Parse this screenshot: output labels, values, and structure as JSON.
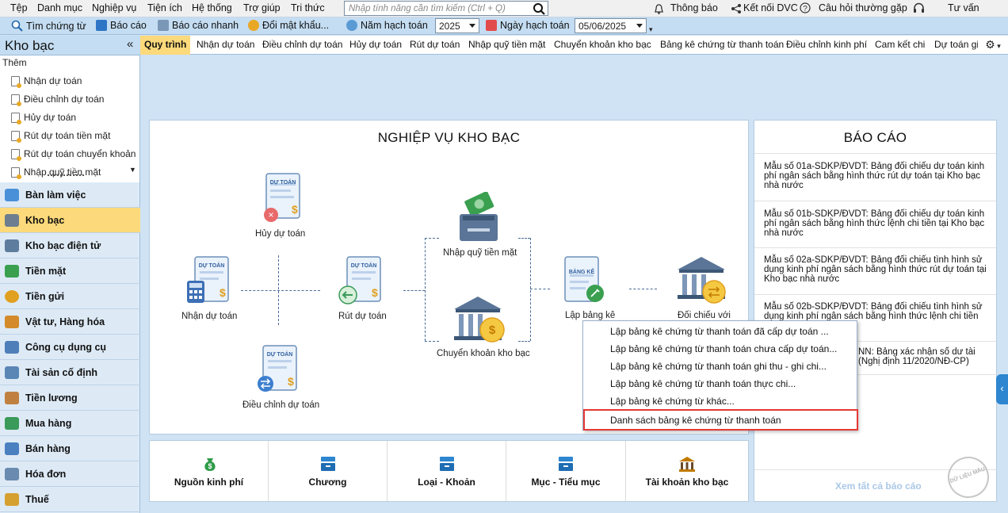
{
  "menubar": {
    "items": [
      "Tệp",
      "Danh mục",
      "Nghiệp vụ",
      "Tiện ích",
      "Hệ thống",
      "Trợ giúp",
      "Tri thức"
    ],
    "search_placeholder": "Nhập tính năng cần tìm kiếm (Ctrl + Q)",
    "notify": "Thông báo",
    "connect": "Kết nối DVC",
    "faq": "Câu hỏi thường gặp",
    "advice": "Tư vấn"
  },
  "toolbar": {
    "find_voucher": "Tìm chứng từ",
    "report": "Báo cáo",
    "quick_report": "Báo cáo nhanh",
    "change_password": "Đổi mật khẩu...",
    "fiscal_year_label": "Năm hạch toán",
    "fiscal_year_value": "2025",
    "posting_date_label": "Ngày hạch toán",
    "posting_date_value": "05/06/2025"
  },
  "sidebar": {
    "title": "Kho bạc",
    "collapse": "«",
    "group": "Thêm",
    "links": [
      "Nhận dự toán",
      "Điều chỉnh dự toán",
      "Hủy dự toán",
      "Rút dự toán tiền mặt",
      "Rút dự toán chuyển khoản",
      "Nhập quỹ tiền mặt"
    ],
    "nav": [
      "Bàn làm việc",
      "Kho bạc",
      "Kho bạc điện tử",
      "Tiền mặt",
      "Tiền gửi",
      "Vật tư, Hàng hóa",
      "Công cụ dụng cụ",
      "Tài sản cố định",
      "Tiền lương",
      "Mua hàng",
      "Bán hàng",
      "Hóa đơn",
      "Thuế"
    ]
  },
  "tabs": [
    "Quy trình",
    "Nhận dự toán",
    "Điều chỉnh dự toán",
    "Hủy dự toán",
    "Rút dự toán",
    "Nhập quỹ tiền mặt",
    "Chuyển khoản kho bạc",
    "Bảng kê chứng từ thanh toán",
    "Điều chỉnh kinh phí",
    "Cam kết chi",
    "Dự toán giữ"
  ],
  "main": {
    "title": "NGHIỆP VỤ KHO BẠC",
    "nodes": {
      "receive": "Nhận dự toán",
      "cancel": "Hủy dự toán",
      "adjust": "Điều chỉnh dự toán",
      "withdraw": "Rút dự toán",
      "cash_in": "Nhập quỹ tiền mặt",
      "transfer": "Chuyển khoản kho bạc",
      "statement": "Lập bảng kê",
      "reconcile": "Đối chiếu với"
    },
    "doc_tag": "DỰ TOÁN",
    "statement_tag": "BẢNG KÊ"
  },
  "report": {
    "title": "BÁO CÁO",
    "items": [
      "Mẫu số 01a-SDKP/ĐVDT: Bảng đối chiếu dự toán kinh phí ngân sách bằng hình thức rút dự toán tại Kho bạc nhà nước",
      "Mẫu số 01b-SDKP/ĐVDT: Bảng đối chiếu dự toán kinh phí ngân sách bằng hình thức lệnh chi tiền tại Kho bạc nhà nước",
      "Mẫu số 02a-SDKP/ĐVDT: Bảng đối chiếu tình hình sử dụng kinh phí ngân sách bằng hình thức rút dự toán tại Kho bạc nhà nước",
      "Mẫu số 02b-SDKP/ĐVDT: Bảng đối chiếu tình hình sử dụng kinh phí ngân sách bằng hình thức lệnh chi tiền tại"
    ],
    "item5_line1": "NN: Bảng xác nhận số dư tài",
    "item5_line2": "(Nghị định 11/2020/NĐ-CP)",
    "view_all": "Xem tất cả báo cáo",
    "stamp": "DỮ LIỆU MẪU"
  },
  "bottom": [
    "Nguồn kinh phí",
    "Chương",
    "Loại - Khoản",
    "Mục - Tiểu mục",
    "Tài khoản kho bạc"
  ],
  "popup": [
    "Lập bảng kê chứng từ thanh toán đã cấp dự toán ...",
    "Lập bảng kê chứng từ thanh toán chưa cấp dự toán...",
    "Lập bảng kê chứng từ thanh toán ghi thu - ghi chi...",
    "Lập bảng kê chứng từ thanh toán thực chi...",
    "Lập bảng kê chứng từ khác...",
    "Danh sách bảng kê chứng từ thanh toán"
  ],
  "colors": {
    "accent": "#fcd97a",
    "highlight": "#e53935",
    "panel_bg": "#cfe3f5"
  }
}
